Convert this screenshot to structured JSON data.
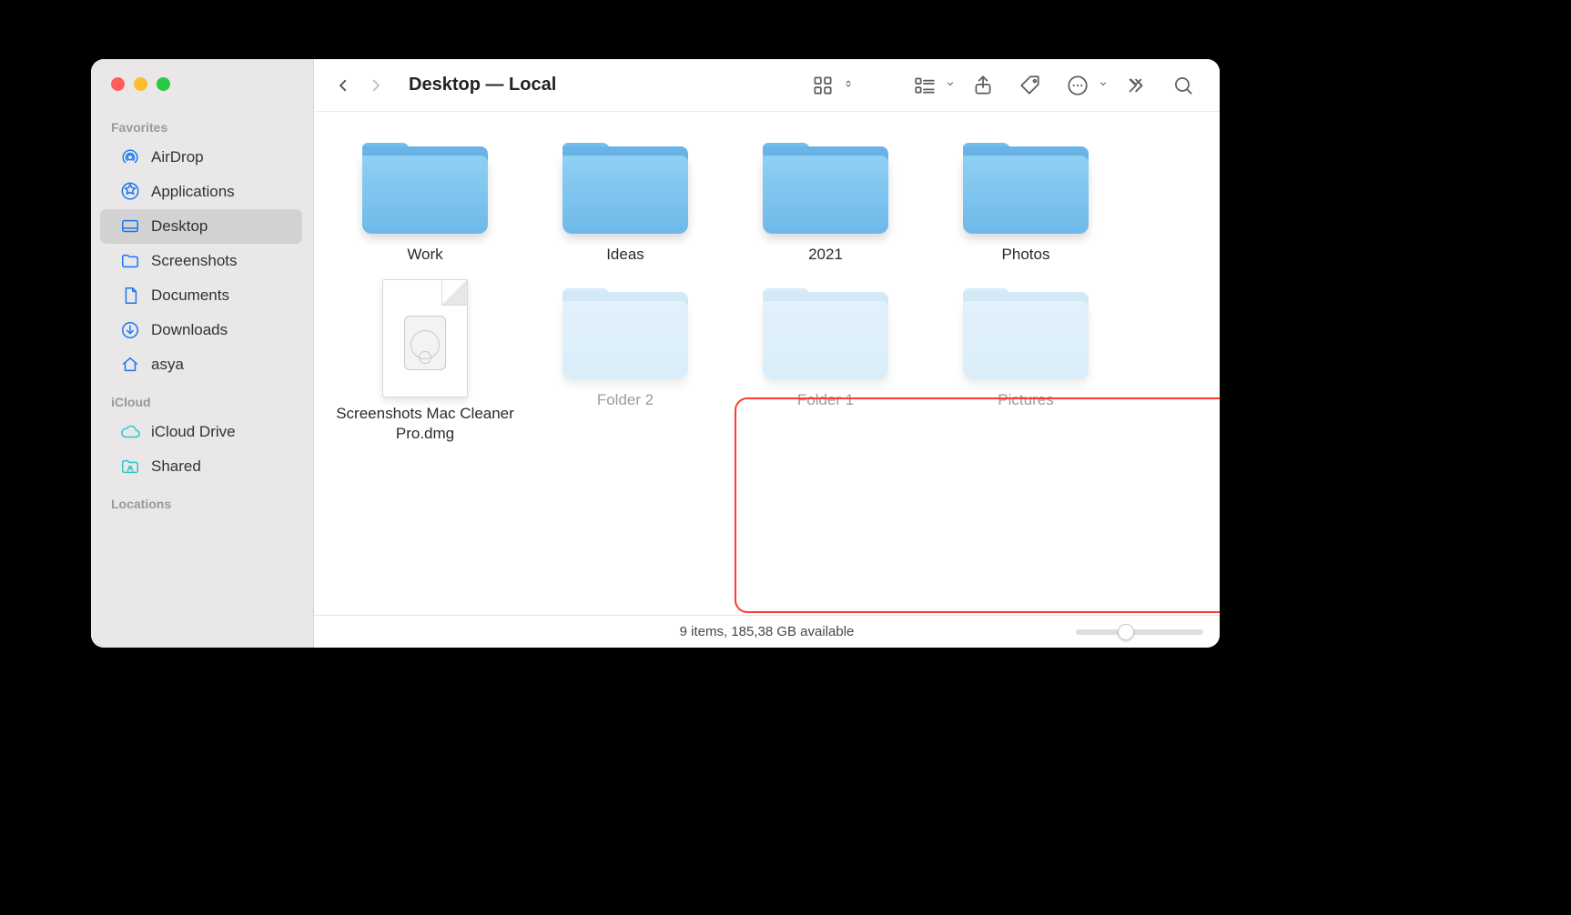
{
  "window": {
    "title": "Desktop — Local"
  },
  "sidebar": {
    "sections": [
      {
        "label": "Favorites",
        "items": [
          {
            "label": "AirDrop"
          },
          {
            "label": "Applications"
          },
          {
            "label": "Desktop"
          },
          {
            "label": "Screenshots"
          },
          {
            "label": "Documents"
          },
          {
            "label": "Downloads"
          },
          {
            "label": "asya"
          }
        ]
      },
      {
        "label": "iCloud",
        "items": [
          {
            "label": "iCloud Drive"
          },
          {
            "label": "Shared"
          }
        ]
      },
      {
        "label": "Locations",
        "items": []
      }
    ]
  },
  "content": {
    "items": [
      {
        "type": "folder",
        "label": "Work"
      },
      {
        "type": "folder",
        "label": "Ideas"
      },
      {
        "type": "folder",
        "label": "2021"
      },
      {
        "type": "folder",
        "label": "Photos"
      },
      {
        "type": "file",
        "label": "Screenshots Mac Cleaner Pro.dmg"
      },
      {
        "type": "folder",
        "label": "Folder 2",
        "hidden": true
      },
      {
        "type": "folder",
        "label": "Folder 1",
        "hidden": true
      },
      {
        "type": "folder",
        "label": "Pictures",
        "hidden": true
      }
    ]
  },
  "status": {
    "text": "9 items, 185,38 GB available"
  }
}
